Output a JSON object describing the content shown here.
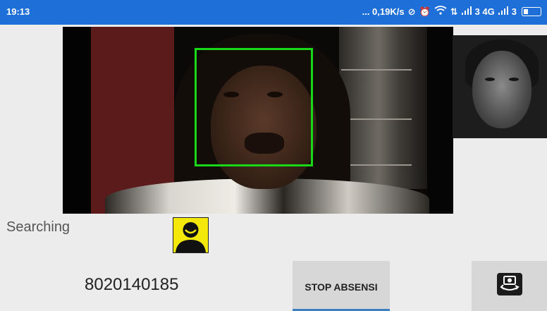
{
  "status_bar": {
    "time": "19:13",
    "network_speed": "... 0,19K/s",
    "sim1_label": "3 4G",
    "sim2_label": "3",
    "bg_color": "#1e6fd8"
  },
  "camera": {
    "face_box_color": "#18d818"
  },
  "main": {
    "status_text": "Searching",
    "id_number": "8020140185",
    "stop_button_label": "STOP ABSENSI",
    "avatar_icon": "user-smile-icon",
    "switch_camera_icon": "switch-camera-icon"
  }
}
